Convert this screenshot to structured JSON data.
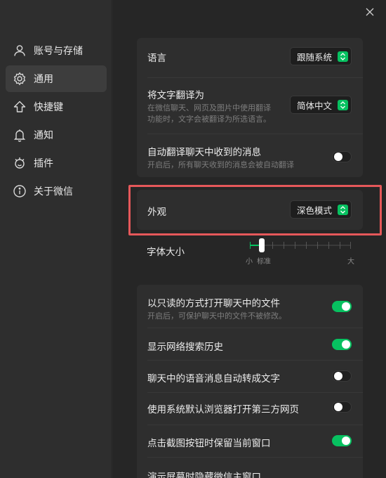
{
  "sidebar": {
    "items": [
      {
        "label": "账号与存储",
        "icon": "user-icon",
        "active": false
      },
      {
        "label": "通用",
        "icon": "gear-icon",
        "active": true
      },
      {
        "label": "快捷键",
        "icon": "shortcut-icon",
        "active": false
      },
      {
        "label": "通知",
        "icon": "bell-icon",
        "active": false
      },
      {
        "label": "插件",
        "icon": "plugin-icon",
        "active": false
      },
      {
        "label": "关于微信",
        "icon": "info-icon",
        "active": false
      }
    ]
  },
  "settings": {
    "language": {
      "label": "语言",
      "value": "跟随系统"
    },
    "translate": {
      "label": "将文字翻译为",
      "desc_line1": "在微信聊天、网页及图片中使用翻译",
      "desc_line2": "功能时，文字会被翻译为所选语言。",
      "value": "简体中文"
    },
    "auto_translate": {
      "label": "自动翻译聊天中收到的消息",
      "desc": "开启后，所有聊天收到的消息会被自动翻译",
      "enabled": false
    },
    "appearance": {
      "label": "外观",
      "value": "深色模式"
    },
    "font_size": {
      "label": "字体大小",
      "small_label": "小",
      "standard_label": "标准",
      "large_label": "大",
      "level": 0.12
    },
    "readonly_files": {
      "label": "以只读的方式打开聊天中的文件",
      "desc": "开启后，可保护聊天中的文件不被修改。",
      "enabled": true
    },
    "search_history": {
      "label": "显示网络搜索历史",
      "enabled": true
    },
    "voice_to_text": {
      "label": "聊天中的语音消息自动转成文字",
      "enabled": false
    },
    "system_browser": {
      "label": "使用系统默认浏览器打开第三方网页",
      "enabled": false
    },
    "keep_window": {
      "label": "点击截图按钮时保留当前窗口",
      "enabled": true
    },
    "hide_window": {
      "label": "演示屏幕时隐藏微信主窗口"
    }
  },
  "colors": {
    "accent": "#07c160",
    "highlight_border": "#e5585a",
    "background": "#262626",
    "card": "#2e2e2e"
  }
}
